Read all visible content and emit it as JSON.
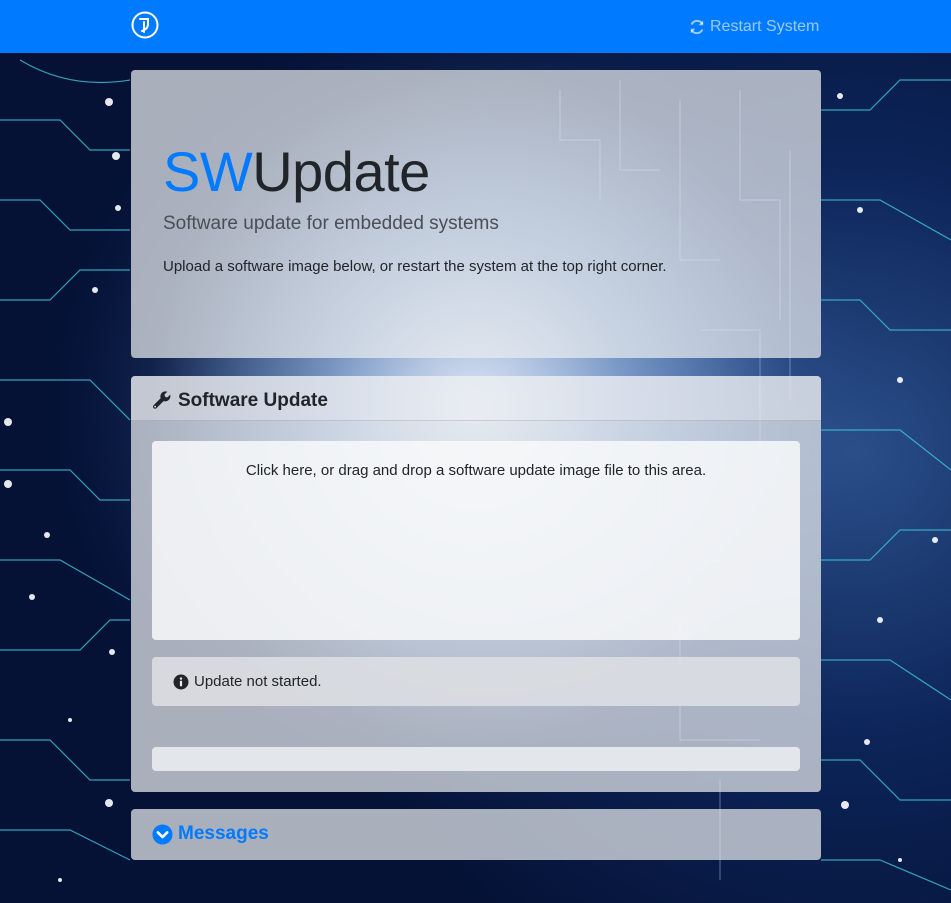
{
  "navbar": {
    "logo_icon": "swupdate-logo-icon",
    "restart_label": "Restart System",
    "restart_icon": "refresh-icon",
    "bg_color": "#007bff"
  },
  "jumbotron": {
    "title_prefix": "SW",
    "title_suffix": "Update",
    "lead": "Software update for embedded systems",
    "intro": "Upload a software image below, or restart the system at the top right corner."
  },
  "update_card": {
    "header_icon": "wrench-icon",
    "title": "Software Update",
    "dropzone_text": "Click here, or drag and drop a software update image file to this area.",
    "status_icon": "info-icon",
    "status_text": "Update not started.",
    "progress_percent": 0
  },
  "messages_card": {
    "icon": "chevron-down-icon",
    "title": "Messages"
  },
  "colors": {
    "accent": "#007bff",
    "text": "#212529"
  }
}
